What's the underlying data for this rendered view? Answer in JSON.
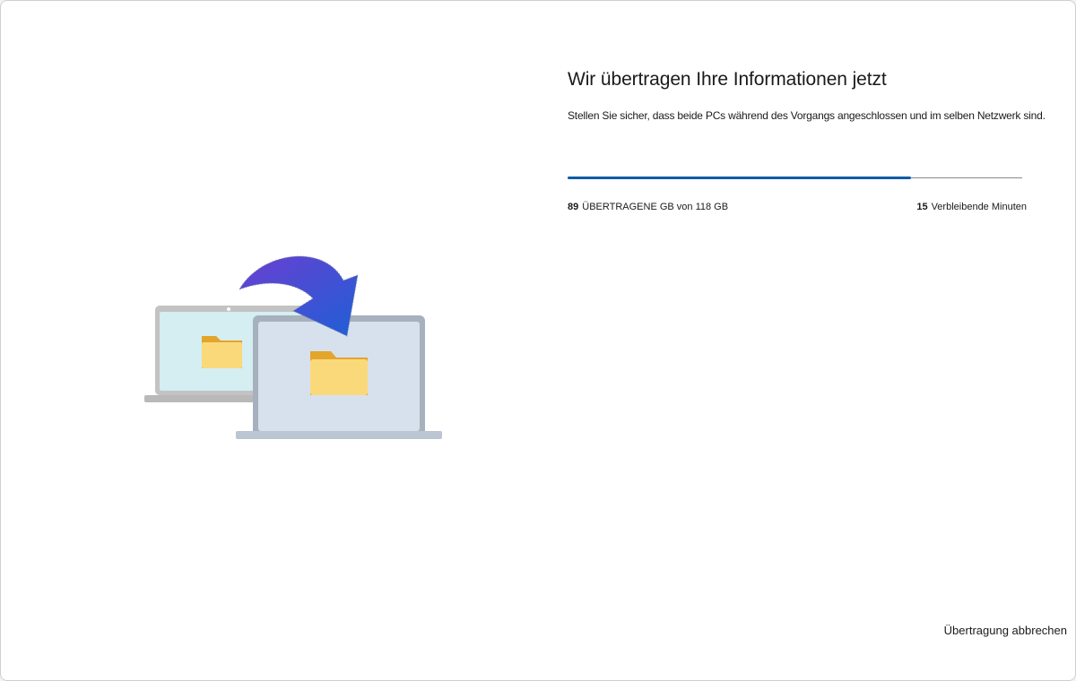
{
  "header": {
    "title": "Wir übertragen Ihre Informationen jetzt",
    "subtitle": "Stellen Sie sicher, dass beide PCs während des Vorgangs angeschlossen und im selben Netzwerk sind."
  },
  "progress": {
    "transferred": "89",
    "transferred_label": "ÜBERTRAGENE GB von 118 GB",
    "remaining": "15",
    "remaining_label": "Verbleibende Minuten",
    "fraction": 0.755,
    "fill_color": "#0f5da8"
  },
  "footer": {
    "cancel_label": "Übertragung abbrechen"
  },
  "icons": {
    "source_laptop": "laptop-icon",
    "target_laptop": "laptop-icon",
    "folder": "folder-icon",
    "arrow": "curved-arrow-icon"
  }
}
